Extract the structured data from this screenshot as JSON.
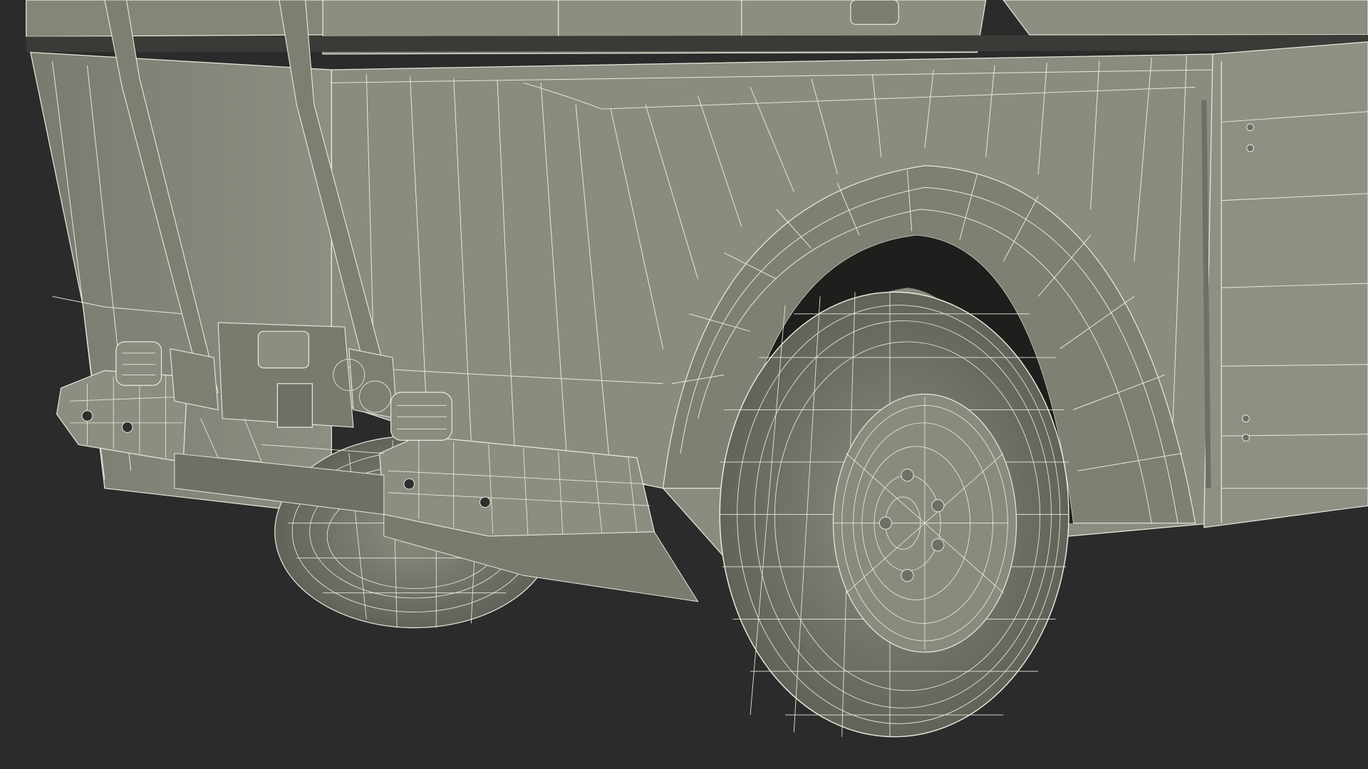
{
  "scene": {
    "subject": "truck-rear-wireframe-render",
    "colors": {
      "background": "#2b2b2b",
      "surface": "#8a8a7e",
      "surface_dark": "#6f6f65",
      "surface_shadow": "#5a5a52",
      "cavity": "#1e1e1c",
      "wire": "#e9e9dc"
    }
  }
}
